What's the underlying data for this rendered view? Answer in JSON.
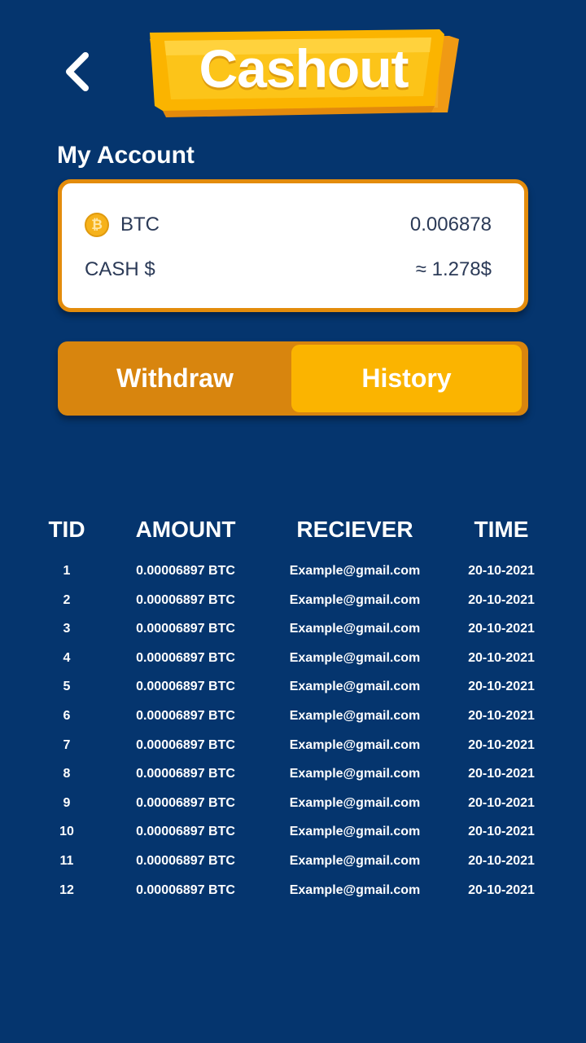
{
  "header": {
    "title": "Cashout",
    "back_icon": "chevron-left-icon"
  },
  "account": {
    "section_title": "My Account",
    "crypto_icon": "bitcoin-coin-icon",
    "crypto_label": "BTC",
    "crypto_value": "0.006878",
    "cash_label": "CASH $",
    "cash_value": "≈ 1.278$"
  },
  "tabs": [
    {
      "label": "Withdraw"
    },
    {
      "label": "History",
      "selected": true
    }
  ],
  "colors": {
    "background": "#05356e",
    "accent_dark": "#d8850e",
    "accent": "#fbb400",
    "card_border": "#e38c0c"
  },
  "history": {
    "columns": [
      "TID",
      "AMOUNT",
      "RECIEVER",
      "TIME"
    ],
    "rows": [
      [
        "1",
        "0.00006897 BTC",
        "Example@gmail.com",
        "20-10-2021"
      ],
      [
        "2",
        "0.00006897 BTC",
        "Example@gmail.com",
        "20-10-2021"
      ],
      [
        "3",
        "0.00006897 BTC",
        "Example@gmail.com",
        "20-10-2021"
      ],
      [
        "4",
        "0.00006897 BTC",
        "Example@gmail.com",
        "20-10-2021"
      ],
      [
        "5",
        "0.00006897 BTC",
        "Example@gmail.com",
        "20-10-2021"
      ],
      [
        "6",
        "0.00006897 BTC",
        "Example@gmail.com",
        "20-10-2021"
      ],
      [
        "7",
        "0.00006897 BTC",
        "Example@gmail.com",
        "20-10-2021"
      ],
      [
        "8",
        "0.00006897 BTC",
        "Example@gmail.com",
        "20-10-2021"
      ],
      [
        "9",
        "0.00006897 BTC",
        "Example@gmail.com",
        "20-10-2021"
      ],
      [
        "10",
        "0.00006897 BTC",
        "Example@gmail.com",
        "20-10-2021"
      ],
      [
        "11",
        "0.00006897 BTC",
        "Example@gmail.com",
        "20-10-2021"
      ],
      [
        "12",
        "0.00006897 BTC",
        "Example@gmail.com",
        "20-10-2021"
      ]
    ]
  }
}
